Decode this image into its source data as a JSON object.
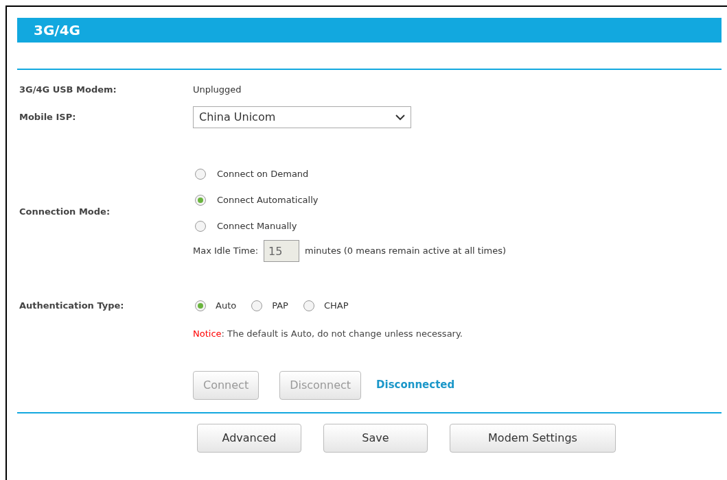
{
  "title": "3G/4G",
  "modem": {
    "label": "3G/4G USB Modem:",
    "value": "Unplugged"
  },
  "isp": {
    "label": "Mobile ISP:",
    "value": "China Unicom"
  },
  "connection_mode": {
    "label": "Connection Mode:",
    "options": [
      {
        "label": "Connect on Demand",
        "selected": false
      },
      {
        "label": "Connect Automatically",
        "selected": true
      },
      {
        "label": "Connect Manually",
        "selected": false
      }
    ],
    "idle": {
      "label": "Max Idle Time:",
      "value": "15",
      "disabled": true,
      "suffix": "minutes (0 means remain active at all times)"
    }
  },
  "authentication": {
    "label": "Authentication Type:",
    "options": [
      {
        "label": "Auto",
        "selected": true
      },
      {
        "label": "PAP",
        "selected": false
      },
      {
        "label": "CHAP",
        "selected": false
      }
    ]
  },
  "notice": {
    "label": "Notice",
    "text": ": The default is Auto, do not change unless necessary."
  },
  "connect_buttons": [
    {
      "label": "Connect",
      "disabled": true
    },
    {
      "label": "Disconnect",
      "disabled": true
    }
  ],
  "connection_status": "Disconnected",
  "buttons": [
    "Advanced",
    "Save",
    "Modem Settings"
  ]
}
